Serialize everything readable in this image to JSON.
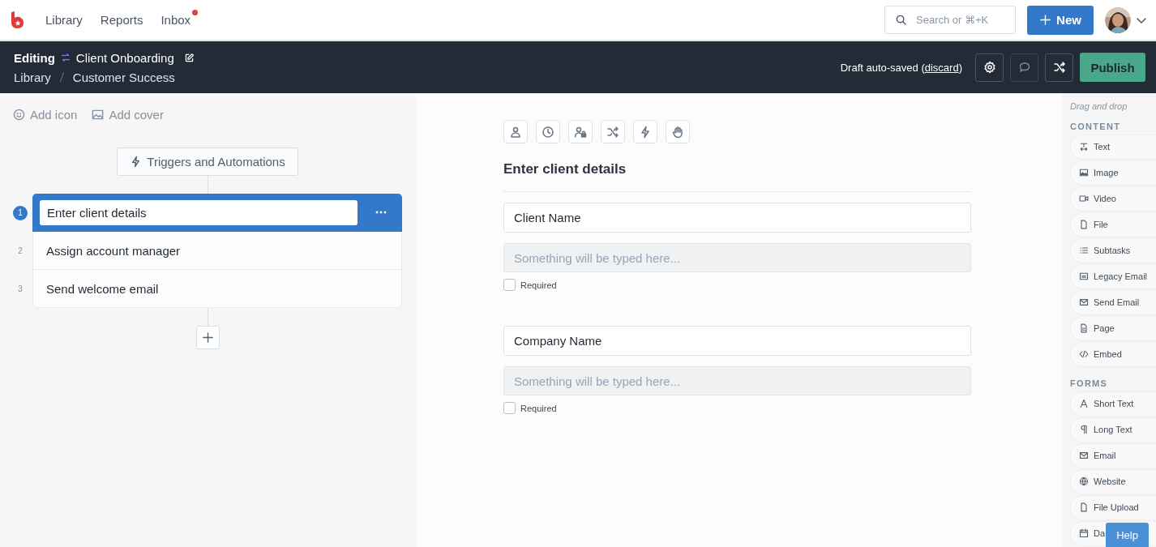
{
  "nav": {
    "links": [
      {
        "label": "Library",
        "badge": false
      },
      {
        "label": "Reports",
        "badge": false
      },
      {
        "label": "Inbox",
        "badge": true
      }
    ],
    "search": {
      "placeholder": "Search or ⌘+K"
    },
    "new_button": "New"
  },
  "header": {
    "mode": "Editing",
    "title": "Client Onboarding",
    "breadcrumb": [
      "Library",
      "Customer Success"
    ],
    "draft_status": "Draft auto-saved",
    "before_discard": "(",
    "discard": "discard",
    "after_discard": ")",
    "publish": "Publish"
  },
  "left_panel": {
    "add_icon": "Add icon",
    "add_cover": "Add cover",
    "triggers": "Triggers and Automations",
    "steps": [
      {
        "number": "1",
        "title": "Enter client details",
        "selected": true
      },
      {
        "number": "2",
        "title": "Assign account manager",
        "selected": false
      },
      {
        "number": "3",
        "title": "Send welcome email",
        "selected": false
      }
    ]
  },
  "editor": {
    "heading": "Enter client details",
    "fields": [
      {
        "label": "Client Name",
        "placeholder": "Something will be typed here...",
        "required_label": "Required",
        "required": false
      },
      {
        "label": "Company Name",
        "placeholder": "Something will be typed here...",
        "required_label": "Required",
        "required": false
      }
    ]
  },
  "sidebar": {
    "hint": "Drag and drop",
    "sections": [
      {
        "title": "CONTENT",
        "items": [
          "Text",
          "Image",
          "Video",
          "File",
          "Subtasks",
          "Legacy Email",
          "Send Email",
          "Page",
          "Embed"
        ]
      },
      {
        "title": "FORMS",
        "items": [
          "Short Text",
          "Long Text",
          "Email",
          "Website",
          "File Upload",
          "Da"
        ]
      }
    ]
  },
  "help_button": "Help"
}
